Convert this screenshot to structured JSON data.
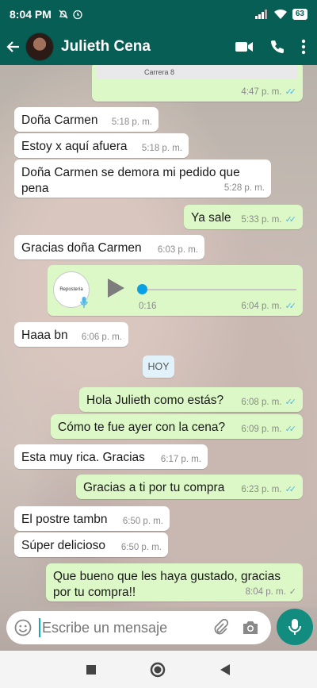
{
  "status_bar": {
    "time": "8:04 PM",
    "battery": "63"
  },
  "header": {
    "contact_name": "Julieth Cena"
  },
  "map_label": "Carrera 8",
  "messages": [
    {
      "dir": "out",
      "time": "4:47 p. m."
    },
    {
      "dir": "in",
      "text": "Doña Carmen",
      "time": "5:18 p. m."
    },
    {
      "dir": "in",
      "text": "Estoy x aquí afuera",
      "time": "5:18 p. m."
    },
    {
      "dir": "in",
      "text_line1": "Doña Carmen se demora mi pedido que",
      "text_line2": "pena",
      "time": "5:28 p. m."
    },
    {
      "dir": "out",
      "text": "Ya sale",
      "time": "5:33 p. m."
    },
    {
      "dir": "in",
      "text": "Gracias doña Carmen",
      "time": "6:03 p. m."
    },
    {
      "dir": "out",
      "type": "audio",
      "duration": "0:16",
      "time": "6:04 p. m."
    },
    {
      "dir": "in",
      "text": "Haaa bn",
      "time": "6:06 p. m."
    },
    {
      "dir": "out",
      "text": "Hola Julieth como estás?",
      "time": "6:08 p. m."
    },
    {
      "dir": "out",
      "text": "Cómo te fue ayer con la cena?",
      "time": "6:09 p. m."
    },
    {
      "dir": "in",
      "text": "Esta muy rica. Gracias",
      "time": "6:17 p. m."
    },
    {
      "dir": "out",
      "text": "Gracias a ti por tu compra",
      "time": "6:23 p. m."
    },
    {
      "dir": "in",
      "text": "El postre tambn",
      "time": "6:50 p. m."
    },
    {
      "dir": "in",
      "text": "Súper delicioso",
      "time": "6:50 p. m."
    },
    {
      "dir": "out",
      "text_line1": "Que bueno que les haya gustado, gracias",
      "text_line2": "por tu compra!!",
      "time": "8:04 p. m."
    }
  ],
  "day_divider": "HOY",
  "composer": {
    "placeholder": "Escribe un mensaje"
  },
  "colors": {
    "header": "#075e54",
    "incoming": "#ffffff",
    "outgoing": "#dcf8c6",
    "accent": "#128c7e",
    "read_ticks": "#4fb6ec"
  },
  "icons": [
    "back-arrow-icon",
    "video-call-icon",
    "phone-icon",
    "more-vert-icon",
    "emoji-icon",
    "attach-icon",
    "camera-icon",
    "mic-icon",
    "play-icon",
    "nav-recents-icon",
    "nav-home-icon",
    "nav-back-icon"
  ]
}
